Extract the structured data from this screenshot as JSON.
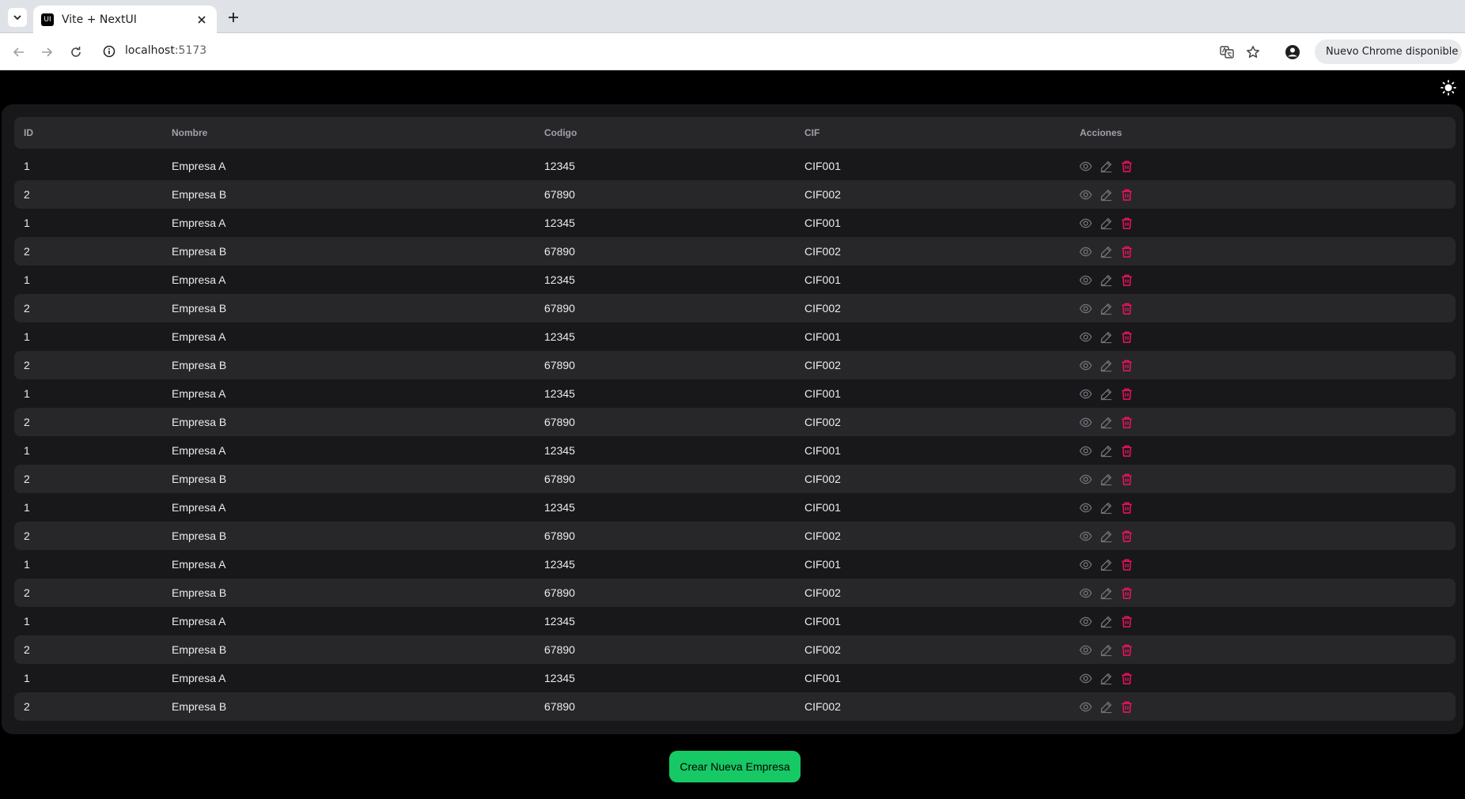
{
  "browser": {
    "tab_title": "Vite + NextUI",
    "favicon_text": "UI",
    "url_host": "localhost",
    "url_port": ":5173",
    "update_chip_label": "Nuevo Chrome disponible"
  },
  "table": {
    "headers": {
      "id": "ID",
      "nombre": "Nombre",
      "codigo": "Codigo",
      "cif": "CIF",
      "acciones": "Acciones"
    },
    "rows": [
      {
        "id": "1",
        "nombre": "Empresa A",
        "codigo": "12345",
        "cif": "CIF001"
      },
      {
        "id": "2",
        "nombre": "Empresa B",
        "codigo": "67890",
        "cif": "CIF002"
      },
      {
        "id": "1",
        "nombre": "Empresa A",
        "codigo": "12345",
        "cif": "CIF001"
      },
      {
        "id": "2",
        "nombre": "Empresa B",
        "codigo": "67890",
        "cif": "CIF002"
      },
      {
        "id": "1",
        "nombre": "Empresa A",
        "codigo": "12345",
        "cif": "CIF001"
      },
      {
        "id": "2",
        "nombre": "Empresa B",
        "codigo": "67890",
        "cif": "CIF002"
      },
      {
        "id": "1",
        "nombre": "Empresa A",
        "codigo": "12345",
        "cif": "CIF001"
      },
      {
        "id": "2",
        "nombre": "Empresa B",
        "codigo": "67890",
        "cif": "CIF002"
      },
      {
        "id": "1",
        "nombre": "Empresa A",
        "codigo": "12345",
        "cif": "CIF001"
      },
      {
        "id": "2",
        "nombre": "Empresa B",
        "codigo": "67890",
        "cif": "CIF002"
      },
      {
        "id": "1",
        "nombre": "Empresa A",
        "codigo": "12345",
        "cif": "CIF001"
      },
      {
        "id": "2",
        "nombre": "Empresa B",
        "codigo": "67890",
        "cif": "CIF002"
      },
      {
        "id": "1",
        "nombre": "Empresa A",
        "codigo": "12345",
        "cif": "CIF001"
      },
      {
        "id": "2",
        "nombre": "Empresa B",
        "codigo": "67890",
        "cif": "CIF002"
      },
      {
        "id": "1",
        "nombre": "Empresa A",
        "codigo": "12345",
        "cif": "CIF001"
      },
      {
        "id": "2",
        "nombre": "Empresa B",
        "codigo": "67890",
        "cif": "CIF002"
      },
      {
        "id": "1",
        "nombre": "Empresa A",
        "codigo": "12345",
        "cif": "CIF001"
      },
      {
        "id": "2",
        "nombre": "Empresa B",
        "codigo": "67890",
        "cif": "CIF002"
      },
      {
        "id": "1",
        "nombre": "Empresa A",
        "codigo": "12345",
        "cif": "CIF001"
      },
      {
        "id": "2",
        "nombre": "Empresa B",
        "codigo": "67890",
        "cif": "CIF002"
      }
    ],
    "row_actions": [
      "eye-icon",
      "edit-icon",
      "trash-icon"
    ]
  },
  "create_button_label": "Crear Nueva Empresa",
  "colors": {
    "accent_green": "#17c964",
    "danger": "#f31260",
    "card_bg": "#18181b",
    "stripe_bg": "#27272a",
    "header_text": "#a1a1aa"
  }
}
